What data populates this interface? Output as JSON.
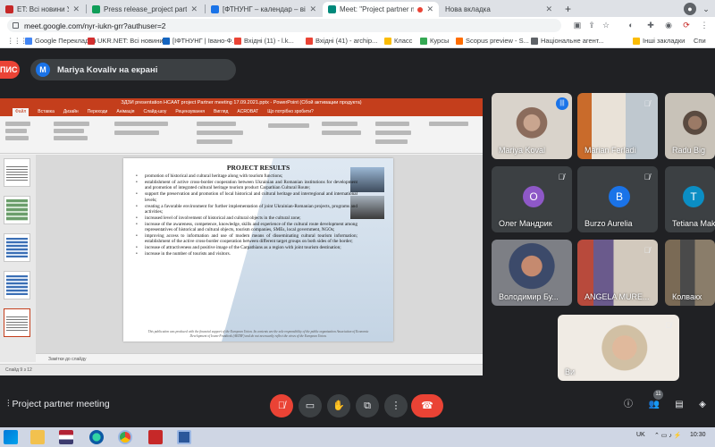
{
  "browser": {
    "tabs": [
      {
        "label": "ET: Всі новини України, св",
        "favicon_color": "#c62828",
        "active": false
      },
      {
        "label": "Press release_project partner me",
        "favicon_color": "#0f9d58",
        "active": false
      },
      {
        "label": "[ФТНУНГ – календар – вівторок",
        "favicon_color": "#1a73e8",
        "active": false
      },
      {
        "label": "Meet: \"Project partner meeti",
        "favicon_color": "#00897b",
        "active": true
      },
      {
        "label": "Нова вкладка",
        "favicon_color": "#9aa0a6",
        "active": false
      }
    ],
    "new_tab": "+",
    "url": "meet.google.com/nyr-iukn-grr?authuser=2",
    "bookmarks": [
      {
        "label": "Google Перекладач",
        "color": "#4285f4"
      },
      {
        "label": "UKR.NET: Всі новини...",
        "color": "#d32f2f"
      },
      {
        "label": "[ІФТНУНГ | Івано-Ф...",
        "color": "#1565c0"
      },
      {
        "label": "Вхідні (11) - l.k...",
        "color": "#ea4335"
      },
      {
        "label": "Вхідні (41) - archip...",
        "color": "#ea4335"
      },
      {
        "label": "Класс",
        "color": "#fbbc04"
      },
      {
        "label": "Курсы",
        "color": "#34a853"
      },
      {
        "label": "Scopus preview - S...",
        "color": "#ff6d00"
      },
      {
        "label": "Національне агент...",
        "color": "#5f6368"
      }
    ],
    "other_bookmarks": "Інші закладки",
    "reading_list": "Спи"
  },
  "meet": {
    "stop_label": "ПИС",
    "presenter_initial": "M",
    "presenting_text": "Mariya Kovaliv на екрані",
    "meeting_name": "Project partner meeting",
    "participant_count": "11",
    "participants": [
      {
        "name": "Mariya Koval",
        "type": "video",
        "speaking": true
      },
      {
        "name": "Marian Ferladi",
        "type": "video",
        "muted": true
      },
      {
        "name": "Radu Big",
        "type": "video",
        "muted": false
      },
      {
        "name": "Олег Мандрик",
        "type": "avatar",
        "initial": "O",
        "color": "#8e58c7"
      },
      {
        "name": "Burzo Aurelia",
        "type": "avatar",
        "initial": "B",
        "color": "#1a73e8"
      },
      {
        "name": "Tetiana Mak",
        "type": "avatar",
        "initial": "T",
        "color": "#0b8ec4"
      },
      {
        "name": "Володимир Бу...",
        "type": "video"
      },
      {
        "name": "ANGELA MURE...",
        "type": "video"
      },
      {
        "name": "Колвакх",
        "type": "video"
      },
      {
        "name": "Ви",
        "type": "video"
      }
    ]
  },
  "powerpoint": {
    "window_title": "ЗДЗИ presentation HCAAT project Partner meeting 17.09.2021.pptx - PowerPoint (Сбой активации продукта)",
    "menu": [
      "Файл",
      "Вставка",
      "Дизайн",
      "Переходи",
      "Анімація",
      "Слайд-шоу",
      "Рецензування",
      "Вигляд",
      "ACROBAT",
      "Що потрібно зробити?"
    ],
    "selected_menu": 0,
    "notes_text": "Замітки до слайду",
    "status_text": "Слайд 9 з 12",
    "slide": {
      "title": "PROJECT RESULTS",
      "bullets": [
        "promotion of historical and cultural heritage along with tourism functions;",
        "establishment of active cross-border cooperation between Ukrainian and Romanian institutions for development and promotion of integrated cultural heritage tourism product Carpathian Cultural Route;",
        "support the preservation and promotion of local historical and cultural heritage and interregional and international levels;",
        "creating a favorable environment for further implementation of joint Ukrainian-Romanian projects, programs and activities;",
        "increased level of involvement of historical and cultural objects in the cultural zone;",
        "increase of the awareness, competence, knowledge, skills and experience of the cultural route development among representatives of historical and cultural objects, tourism companies, SMEs, local government, NGOs;",
        "improving access to information and use of modern means of disseminating cultural tourism information; establishment of the active cross-border cooperation between different target groups on both sides of the border;",
        "increase of attractiveness and positive image of the Carpathians as a region with joint tourism destination;",
        "increase in the number of tourists and visitors."
      ],
      "footer": "This publication was produced with the financial support of the European Union. Its contents are the sole responsibility of the public organization Association of Economic Development of Ivano-Frankivsk (AEDIF) and do not necessarily reflect the views of the European Union."
    }
  },
  "taskbar": {
    "lang": "UK",
    "time": "10:30"
  },
  "colors": {
    "meet_bg": "#202124",
    "tile_bg": "#3c4043",
    "danger": "#ea4335",
    "accent": "#1a73e8",
    "pp_accent": "#c43e1c"
  },
  "icons": {
    "mic_off": "microphone-off-icon",
    "camera": "camera-icon",
    "hand": "raise-hand-icon",
    "present": "present-screen-icon",
    "more": "more-vert-icon",
    "end_call": "end-call-icon",
    "info": "info-icon",
    "people": "people-icon",
    "chat": "chat-icon",
    "activities": "activities-icon"
  }
}
